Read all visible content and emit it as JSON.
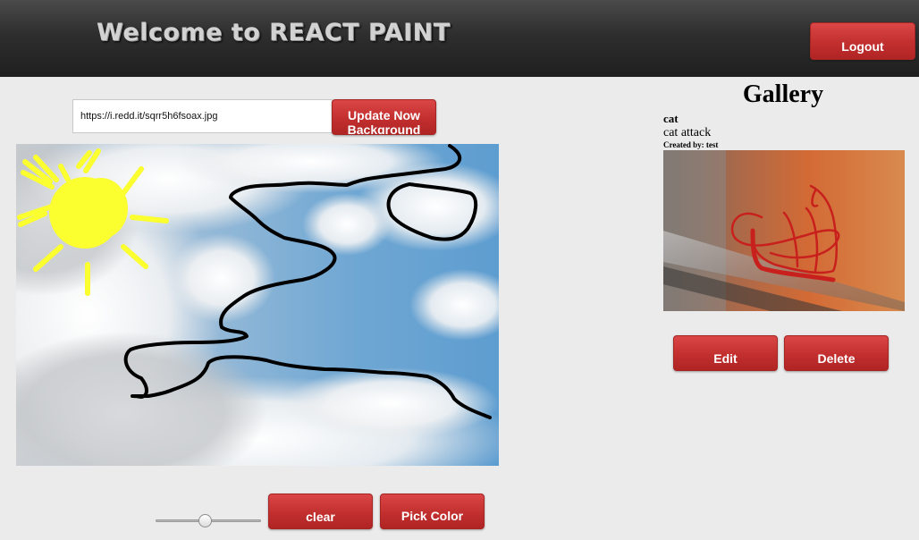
{
  "header": {
    "title": "Welcome to REACT PAINT",
    "logout_label": "Logout"
  },
  "editor": {
    "background_url": "https://i.redd.it/sqrr5h6fsoax.jpg",
    "update_button_label": "Update Now Background",
    "clear_label": "clear",
    "pick_color_label": "Pick Color",
    "brush_size_level": 0.47,
    "stroke_colors": {
      "sun": "#fbff2f",
      "outline": "#000000"
    }
  },
  "gallery": {
    "title": "Gallery",
    "items": [
      {
        "name": "cat",
        "description": "cat attack",
        "created_by_label": "Created by:",
        "created_by": "test",
        "stroke_color": "#c8201d",
        "edit_label": "Edit",
        "delete_label": "Delete"
      }
    ]
  },
  "colors": {
    "accent": "#c93434",
    "header_bg": "#2e2e2e",
    "page_bg": "#ebebeb"
  }
}
